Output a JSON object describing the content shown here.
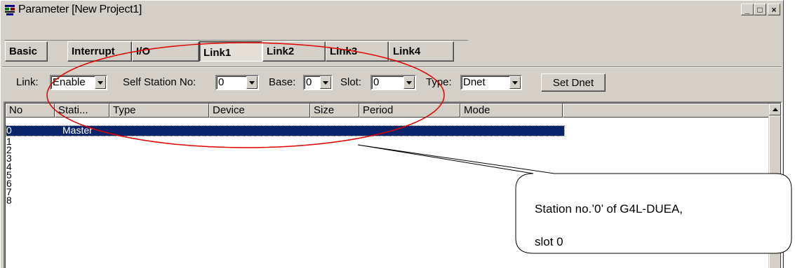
{
  "window": {
    "title": "Parameter [New Project1]",
    "minimize": "_",
    "restore": "□",
    "close": "×"
  },
  "tabs": [
    {
      "label": "Basic"
    },
    {
      "label": "Interrupt"
    },
    {
      "label": "I/O"
    },
    {
      "label": "Link1"
    },
    {
      "label": "Link2"
    },
    {
      "label": "Link3"
    },
    {
      "label": "Link4"
    }
  ],
  "options": {
    "link_label": "Link:",
    "link_value": "Enable",
    "self_station_label": "Self Station No:",
    "self_station_value": "0",
    "base_label": "Base:",
    "base_value": "0",
    "slot_label": "Slot:",
    "slot_value": "0",
    "type_label": "Type:",
    "type_value": "Dnet",
    "set_button": "Set Dnet"
  },
  "table": {
    "columns": [
      "No",
      "Stati...",
      "Type",
      "Device",
      "Size",
      "Period",
      "Mode"
    ],
    "rows": [
      {
        "no": "0",
        "station": "Master"
      },
      {
        "no": "1",
        "station": ""
      },
      {
        "no": "2",
        "station": ""
      },
      {
        "no": "3",
        "station": ""
      },
      {
        "no": "4",
        "station": ""
      },
      {
        "no": "5",
        "station": ""
      },
      {
        "no": "6",
        "station": ""
      },
      {
        "no": "7",
        "station": ""
      },
      {
        "no": "8",
        "station": ""
      }
    ]
  },
  "callout": {
    "line1": "Station no.’0’ of G4L-DUEA,",
    "line2": "slot 0"
  },
  "colors": {
    "selection": "#0a246a",
    "annotation": "#e00000"
  }
}
